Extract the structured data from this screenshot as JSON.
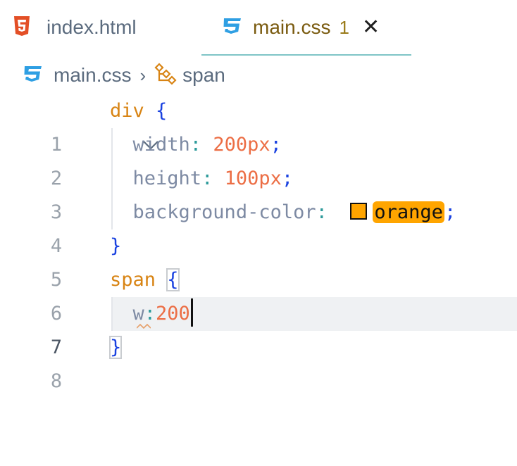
{
  "tabs": [
    {
      "label": "index.html",
      "icon": "html5-icon"
    },
    {
      "label": "main.css",
      "icon": "css3-icon",
      "problems": "1",
      "close_glyph": "✕"
    }
  ],
  "breadcrumb": {
    "file": "main.css",
    "separator": "›",
    "symbol": "span",
    "symbol_icon": "selector-icon"
  },
  "editor": {
    "line_numbers": [
      "1",
      "2",
      "3",
      "4",
      "5",
      "6",
      "7",
      "8"
    ],
    "active_line": "7",
    "lines": {
      "l1": {
        "selector": "div",
        "brace": "{"
      },
      "l2": {
        "prop": "width",
        "colon": ":",
        "value": "200px",
        "semi": ";"
      },
      "l3": {
        "prop": "height",
        "colon": ":",
        "value": "100px",
        "semi": ";"
      },
      "l4": {
        "prop": "background-color",
        "colon": ":",
        "value": "orange",
        "semi": ";"
      },
      "l5": {
        "brace": "}"
      },
      "l6": {
        "selector": "span",
        "brace": "{"
      },
      "l7": {
        "prop": "w",
        "colon": ":",
        "value": "200"
      },
      "l8": {
        "brace": "}"
      }
    },
    "colors": {
      "selector": "#d88414",
      "brace": "#1a42e0",
      "property": "#7d8aa3",
      "number": "#ec6e45",
      "swatch": "#ffa500"
    }
  }
}
